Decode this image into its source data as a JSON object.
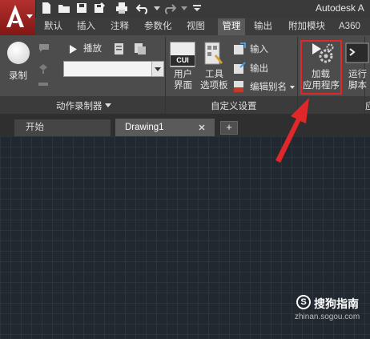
{
  "window": {
    "title": "Autodesk A"
  },
  "quick_access": [
    "new-icon",
    "open-icon",
    "save-icon",
    "saveas-icon",
    "print-icon",
    "undo-icon",
    "undo-dropdown-icon",
    "redo-icon",
    "redo-dropdown-icon",
    "qat-customize-icon"
  ],
  "ribbon_tabs": [
    "默认",
    "插入",
    "注释",
    "参数化",
    "视图",
    "管理",
    "输出",
    "附加模块",
    "A360"
  ],
  "active_tab": "管理",
  "action_recorder": {
    "record_label": "录制",
    "play_label": "播放",
    "panel_label": "动作录制器"
  },
  "customization": {
    "user_interface_label_1": "用户",
    "user_interface_label_2": "界面",
    "tool_palettes_label_1": "工具",
    "tool_palettes_label_2": "选项板",
    "import_label": "输入",
    "export_label": "输出",
    "edit_alias_label": "编辑别名",
    "panel_label": "自定义设置",
    "cui_icon_text": "CUI"
  },
  "applications": {
    "load_app_label_1": "加载",
    "load_app_label_2": "应用程序",
    "run_script_label_1": "运行",
    "run_script_label_2": "脚本",
    "panel_label_partial": "应"
  },
  "doc_tabs": {
    "start": "开始",
    "drawing": "Drawing1",
    "add": "+"
  },
  "watermark": {
    "text": "搜狗指南",
    "url": "zhinan.sogou.com",
    "logo_letter": "S"
  },
  "colors": {
    "highlight_box": "#e0282a",
    "arrow": "#e0282a",
    "app_button": "#a8221f"
  }
}
